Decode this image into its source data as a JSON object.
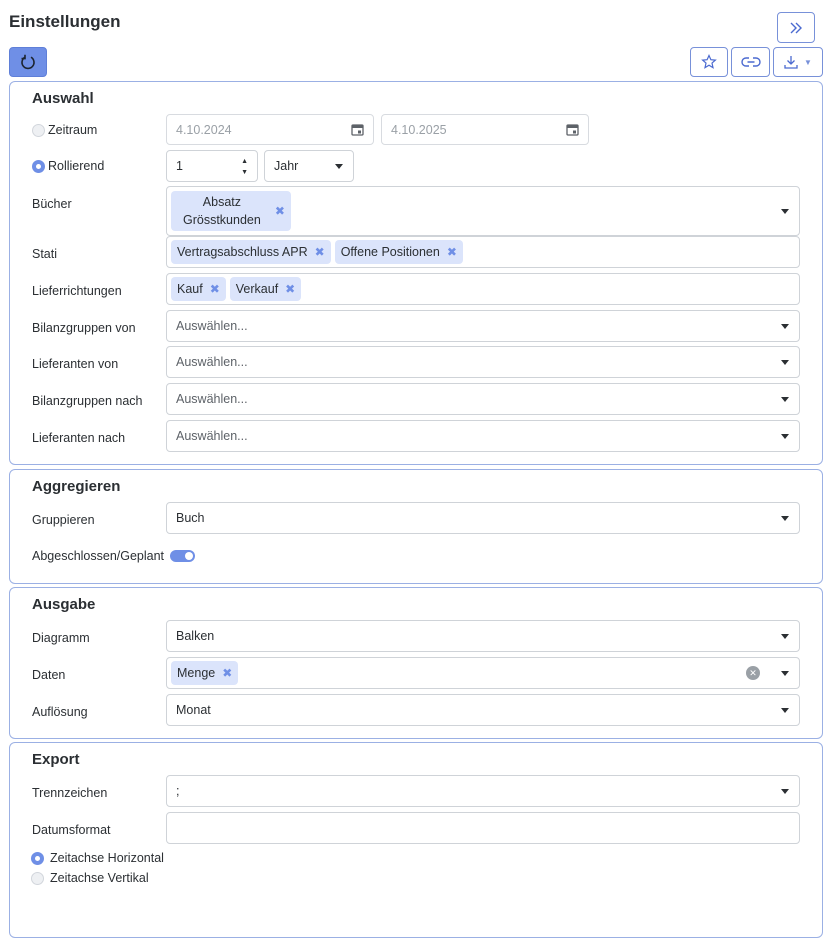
{
  "page": {
    "title": "Einstellungen"
  },
  "toolbar": {
    "expand_icon": "double-chevron-right-icon",
    "refresh_icon": "refresh-icon",
    "favorite_icon": "star-icon",
    "link_icon": "link-icon",
    "download_icon": "download-icon"
  },
  "auswahl": {
    "title": "Auswahl",
    "zeitraum": {
      "label": "Zeitraum",
      "from": "4.10.2024",
      "to": "4.10.2025",
      "selected": false
    },
    "rollierend": {
      "label": "Rollierend",
      "value": "1",
      "unit": "Jahr",
      "selected": true
    },
    "buecher": {
      "label": "Bücher",
      "chips": [
        {
          "line1": "Absatz",
          "line2": "Grösstkunden"
        }
      ]
    },
    "stati": {
      "label": "Stati",
      "chips": [
        "Vertragsabschluss APR",
        "Offene Positionen"
      ]
    },
    "lieferrichtungen": {
      "label": "Lieferrichtungen",
      "chips": [
        "Kauf",
        "Verkauf"
      ]
    },
    "bilanzgruppen_von": {
      "label": "Bilanzgruppen von",
      "placeholder": "Auswählen..."
    },
    "lieferanten_von": {
      "label": "Lieferanten von",
      "placeholder": "Auswählen..."
    },
    "bilanzgruppen_nach": {
      "label": "Bilanzgruppen nach",
      "placeholder": "Auswählen..."
    },
    "lieferanten_nach": {
      "label": "Lieferanten nach",
      "placeholder": "Auswählen..."
    }
  },
  "aggregieren": {
    "title": "Aggregieren",
    "gruppieren": {
      "label": "Gruppieren",
      "value": "Buch"
    },
    "abgeschlossen": {
      "label": "Abgeschlossen/Geplant",
      "on": true
    }
  },
  "ausgabe": {
    "title": "Ausgabe",
    "diagramm": {
      "label": "Diagramm",
      "value": "Balken"
    },
    "daten": {
      "label": "Daten",
      "chips": [
        "Menge"
      ]
    },
    "aufloesung": {
      "label": "Auflösung",
      "value": "Monat"
    }
  },
  "export": {
    "title": "Export",
    "trennzeichen": {
      "label": "Trennzeichen",
      "value": ";"
    },
    "datumsformat": {
      "label": "Datumsformat",
      "value": ""
    },
    "zeitachse_horizontal": {
      "label": "Zeitachse Horizontal",
      "selected": true
    },
    "zeitachse_vertikal": {
      "label": "Zeitachse Vertikal",
      "selected": false
    }
  },
  "colors": {
    "accent": "#6f8fe6",
    "border": "#9bb0e4",
    "chip": "#dbe4fb"
  }
}
